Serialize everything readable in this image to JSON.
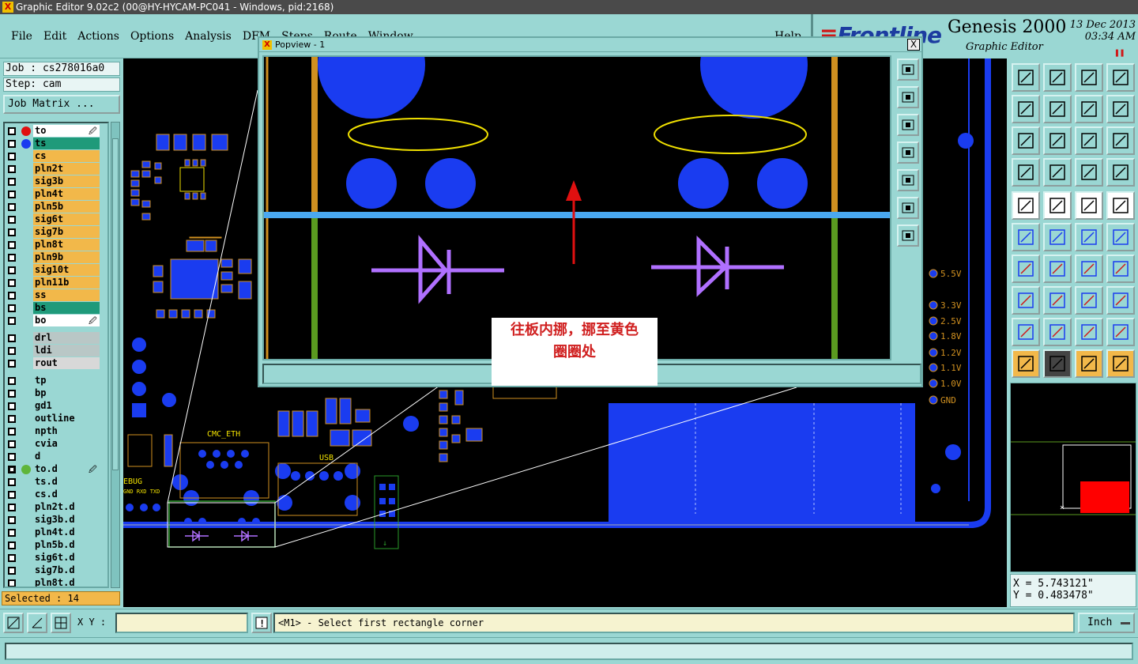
{
  "window": {
    "title": "Graphic Editor 9.02c2 (00@HY-HYCAM-PC041 - Windows, pid:2168)"
  },
  "menu": {
    "items": [
      "File",
      "Edit",
      "Actions",
      "Options",
      "Analysis",
      "DFM",
      "Steps",
      "Route",
      "Window"
    ],
    "help": "Help"
  },
  "brand": {
    "logo": "Frontline",
    "product": "Genesis 2000",
    "subtitle": "Graphic Editor",
    "date": "13 Dec 2013",
    "time": "03:34 AM"
  },
  "job": {
    "job_label": "Job : cs278016a0",
    "step_label": "Step: cam",
    "matrix_button": "Job Matrix ..."
  },
  "layers": [
    {
      "name": "to",
      "color": "#ffffff",
      "dot": "#e01010",
      "affected": true
    },
    {
      "name": "ts",
      "color": "#1f9a7a",
      "dot": "#1a3cf0",
      "affected": false
    },
    {
      "name": "cs",
      "color": "#f2b84a",
      "dot": "",
      "affected": false
    },
    {
      "name": "pln2t",
      "color": "#f2b84a",
      "dot": "",
      "affected": false
    },
    {
      "name": "sig3b",
      "color": "#f2b84a",
      "dot": "",
      "affected": false
    },
    {
      "name": "pln4t",
      "color": "#f2b84a",
      "dot": "",
      "affected": false
    },
    {
      "name": "pln5b",
      "color": "#f2b84a",
      "dot": "",
      "affected": false
    },
    {
      "name": "sig6t",
      "color": "#f2b84a",
      "dot": "",
      "affected": false
    },
    {
      "name": "sig7b",
      "color": "#f2b84a",
      "dot": "",
      "affected": false
    },
    {
      "name": "pln8t",
      "color": "#f2b84a",
      "dot": "",
      "affected": false
    },
    {
      "name": "pln9b",
      "color": "#f2b84a",
      "dot": "",
      "affected": false
    },
    {
      "name": "sig10t",
      "color": "#f2b84a",
      "dot": "",
      "affected": false
    },
    {
      "name": "pln11b",
      "color": "#f2b84a",
      "dot": "",
      "affected": false
    },
    {
      "name": "ss",
      "color": "#f2b84a",
      "dot": "",
      "affected": false
    },
    {
      "name": "bs",
      "color": "#1f9a7a",
      "dot": "",
      "affected": false
    },
    {
      "name": "bo",
      "color": "#ffffff",
      "dot": "",
      "affected": true
    },
    {
      "name": "drl",
      "color": "#b9c7c6",
      "dot": "",
      "affected": false
    },
    {
      "name": "ldi",
      "color": "#b9c7c6",
      "dot": "",
      "affected": false
    },
    {
      "name": "rout",
      "color": "#d8d8d8",
      "dot": "",
      "affected": false
    },
    {
      "name": "tp",
      "color": "#9ad7d3",
      "dot": "",
      "affected": false
    },
    {
      "name": "bp",
      "color": "#9ad7d3",
      "dot": "",
      "affected": false
    },
    {
      "name": "gd1",
      "color": "#9ad7d3",
      "dot": "",
      "affected": false
    },
    {
      "name": "outline",
      "color": "#9ad7d3",
      "dot": "",
      "affected": false
    },
    {
      "name": "npth",
      "color": "#9ad7d3",
      "dot": "",
      "affected": false
    },
    {
      "name": "cvia",
      "color": "#9ad7d3",
      "dot": "",
      "affected": false
    },
    {
      "name": "d",
      "color": "#9ad7d3",
      "dot": "",
      "affected": false
    },
    {
      "name": "to.d",
      "color": "#9ad7d3",
      "dot": "#5fb53a",
      "affected": true,
      "work": true
    },
    {
      "name": "ts.d",
      "color": "#9ad7d3",
      "dot": "",
      "affected": false
    },
    {
      "name": "cs.d",
      "color": "#9ad7d3",
      "dot": "",
      "affected": false
    },
    {
      "name": "pln2t.d",
      "color": "#9ad7d3",
      "dot": "",
      "affected": false
    },
    {
      "name": "sig3b.d",
      "color": "#9ad7d3",
      "dot": "",
      "affected": false
    },
    {
      "name": "pln4t.d",
      "color": "#9ad7d3",
      "dot": "",
      "affected": false
    },
    {
      "name": "pln5b.d",
      "color": "#9ad7d3",
      "dot": "",
      "affected": false
    },
    {
      "name": "sig6t.d",
      "color": "#9ad7d3",
      "dot": "",
      "affected": false
    },
    {
      "name": "sig7b.d",
      "color": "#9ad7d3",
      "dot": "",
      "affected": false
    },
    {
      "name": "pln8t.d",
      "color": "#9ad7d3",
      "dot": "",
      "affected": false
    }
  ],
  "selected": "Selected : 14",
  "popview": {
    "title": "Popview - 1",
    "close": "X"
  },
  "annotation": {
    "line1": "往板内挪，挪至黄色",
    "line2": "圈圈处"
  },
  "board_labels": {
    "silk_cmc": "CMC_ETH",
    "silk_usb": "USB",
    "silk_debug": "EBUG",
    "silk_debug_pins": "GND RXD TXD"
  },
  "test_points": [
    "5.5V",
    "3.3V",
    "2.5V",
    "1.8V",
    "1.2V",
    "1.1V",
    "1.0V",
    "GND"
  ],
  "coords": {
    "x": "X = 5.743121\"",
    "y": "Y = 0.483478\""
  },
  "command": {
    "xy_label": "X Y :",
    "xy_value": "",
    "message": "<M1> - Select first rectangle corner",
    "units": "Inch"
  },
  "icons": {
    "zoom_tools": [
      "zoom-home-icon",
      "zoom-in-icon",
      "zoom-out-icon",
      "pan-left-icon",
      "pan-right-icon",
      "fit-icon",
      "zoom-reset-icon"
    ],
    "colors": {
      "pad": "#1a3cf0",
      "silk_yellow": "#f0e000",
      "diode": "#b070ff",
      "arrow": "#e01010",
      "teal_bg": "#9ad7d3"
    }
  }
}
